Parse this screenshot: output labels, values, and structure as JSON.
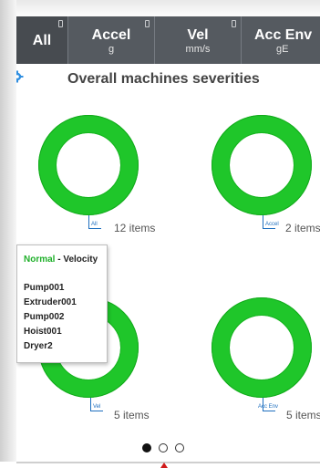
{
  "tabs": [
    {
      "label": "All",
      "unit": ""
    },
    {
      "label": "Accel",
      "unit": "g"
    },
    {
      "label": "Vel",
      "unit": "mm/s"
    },
    {
      "label": "Acc Env",
      "unit": "gE"
    }
  ],
  "title": "Overall machines severities",
  "charts": [
    {
      "tag": "All",
      "count": "12 items"
    },
    {
      "tag": "Accel",
      "count": "2 items"
    },
    {
      "tag": "Vel",
      "count": "5 items"
    },
    {
      "tag": "Acc Env",
      "count": "5 items"
    }
  ],
  "tooltip": {
    "status": "Normal",
    "separator": " - ",
    "measure": "Velocity",
    "items": [
      "Pump001",
      "Extruder001",
      "Pump002",
      "Hoist001",
      "Dryer2"
    ]
  },
  "colors": {
    "normal": "#1fc62a",
    "tabbar": "#555a60"
  },
  "pager": {
    "pages": 3,
    "active": 1
  }
}
